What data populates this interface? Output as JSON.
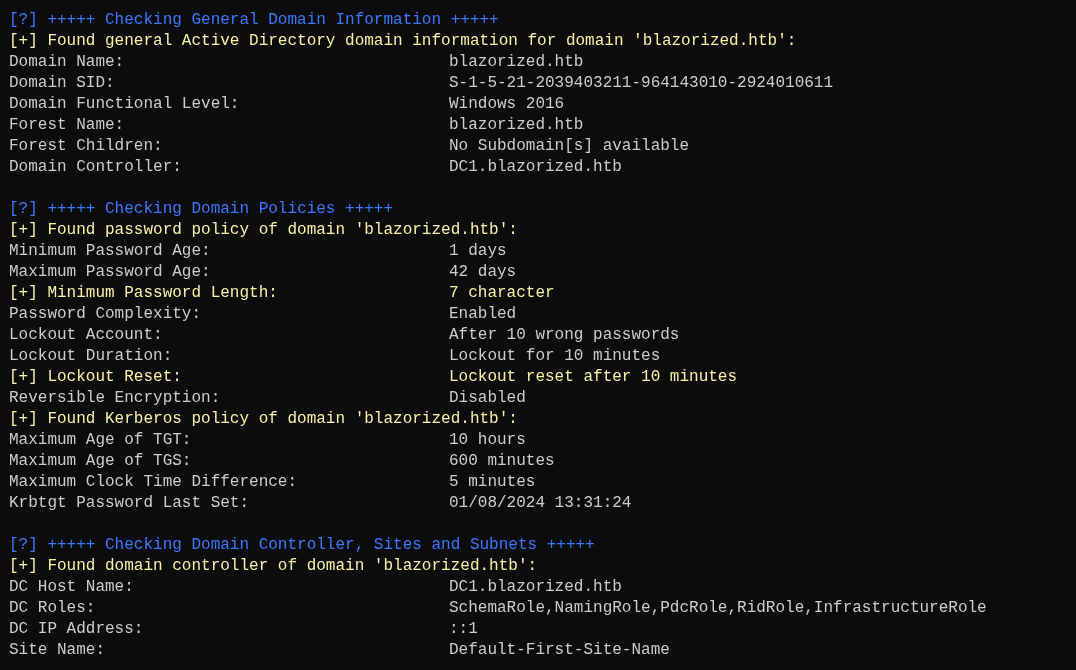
{
  "terminal": {
    "lines": [
      {
        "kind": "header",
        "text": "[?] +++++ Checking General Domain Information +++++"
      },
      {
        "kind": "found",
        "text": "[+] Found general Active Directory domain information for domain 'blazorized.htb':"
      },
      {
        "kind": "field",
        "label": "Domain Name:",
        "value": "blazorized.htb"
      },
      {
        "kind": "field",
        "label": "Domain SID:",
        "value": "S-1-5-21-2039403211-964143010-2924010611"
      },
      {
        "kind": "field",
        "label": "Domain Functional Level:",
        "value": "Windows 2016"
      },
      {
        "kind": "field",
        "label": "Forest Name:",
        "value": "blazorized.htb"
      },
      {
        "kind": "field",
        "label": "Forest Children:",
        "value": "No Subdomain[s] available"
      },
      {
        "kind": "field",
        "label": "Domain Controller:",
        "value": "DC1.blazorized.htb"
      },
      {
        "kind": "blank"
      },
      {
        "kind": "header",
        "text": "[?] +++++ Checking Domain Policies +++++"
      },
      {
        "kind": "found",
        "text": "[+] Found password policy of domain 'blazorized.htb':"
      },
      {
        "kind": "field",
        "label": "Minimum Password Age:",
        "value": "1 days"
      },
      {
        "kind": "field",
        "label": "Maximum Password Age:",
        "value": "42 days"
      },
      {
        "kind": "finding",
        "label": "[+] Minimum Password Length:",
        "value": "7 character"
      },
      {
        "kind": "field",
        "label": "Password Complexity:",
        "value": "Enabled"
      },
      {
        "kind": "field",
        "label": "Lockout Account:",
        "value": "After 10 wrong passwords"
      },
      {
        "kind": "field",
        "label": "Lockout Duration:",
        "value": "Lockout for 10 minutes"
      },
      {
        "kind": "finding",
        "label": "[+] Lockout Reset:",
        "value": "Lockout reset after 10 minutes"
      },
      {
        "kind": "field",
        "label": "Reversible Encryption:",
        "value": "Disabled"
      },
      {
        "kind": "found",
        "text": "[+] Found Kerberos policy of domain 'blazorized.htb':"
      },
      {
        "kind": "field",
        "label": "Maximum Age of TGT:",
        "value": "10 hours"
      },
      {
        "kind": "field",
        "label": "Maximum Age of TGS:",
        "value": "600 minutes"
      },
      {
        "kind": "field",
        "label": "Maximum Clock Time Difference:",
        "value": "5 minutes"
      },
      {
        "kind": "field",
        "label": "Krbtgt Password Last Set:",
        "value": "01/08/2024 13:31:24"
      },
      {
        "kind": "blank"
      },
      {
        "kind": "header",
        "text": "[?] +++++ Checking Domain Controller, Sites and Subnets +++++"
      },
      {
        "kind": "found",
        "text": "[+] Found domain controller of domain 'blazorized.htb':"
      },
      {
        "kind": "field",
        "label": "DC Host Name:",
        "value": "DC1.blazorized.htb"
      },
      {
        "kind": "field",
        "label": "DC Roles:",
        "value": "SchemaRole,NamingRole,PdcRole,RidRole,InfrastructureRole"
      },
      {
        "kind": "field",
        "label": "DC IP Address:",
        "value": "::1"
      },
      {
        "kind": "field",
        "label": "Site Name:",
        "value": "Default-First-Site-Name"
      }
    ]
  }
}
